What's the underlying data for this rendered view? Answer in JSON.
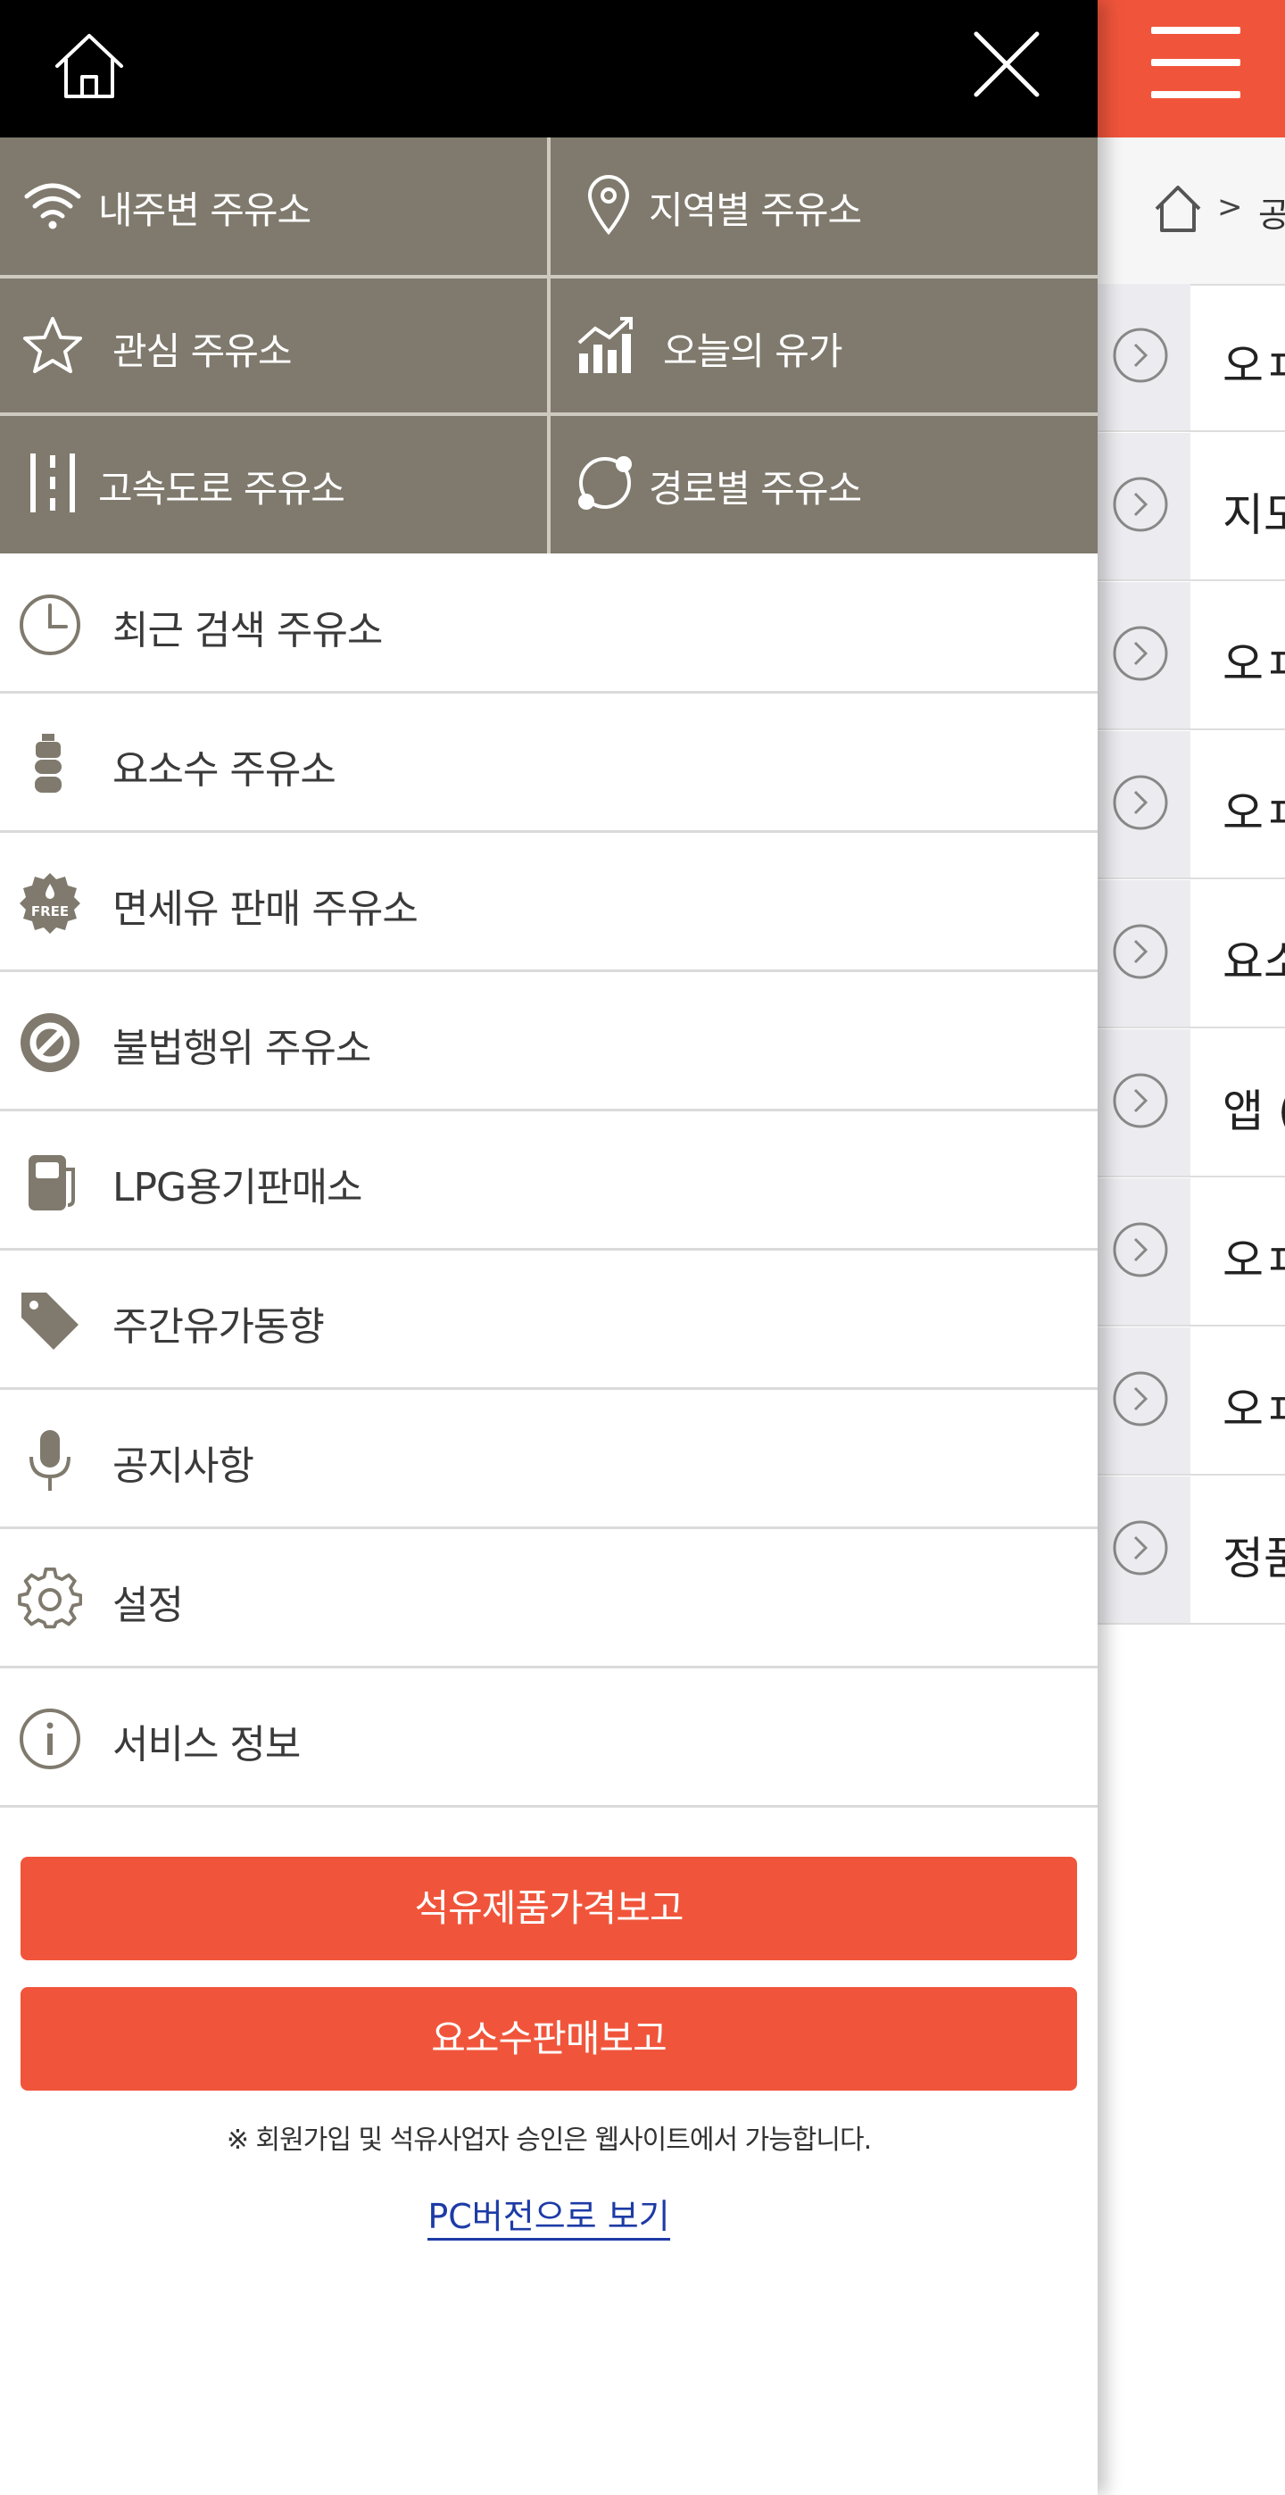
{
  "drawer": {
    "quick_grid": [
      {
        "label": "내주변 주유소",
        "icon": "wifi-icon"
      },
      {
        "label": "지역별 주유소",
        "icon": "location-pin-icon"
      },
      {
        "label": "관심 주유소",
        "icon": "star-icon"
      },
      {
        "label": "오늘의 유가",
        "icon": "chart-icon"
      },
      {
        "label": "고속도로 주유소",
        "icon": "highway-icon"
      },
      {
        "label": "경로별 주유소",
        "icon": "route-icon"
      }
    ],
    "menu": [
      {
        "label": "최근 검색 주유소",
        "icon": "clock-icon"
      },
      {
        "label": "요소수 주유소",
        "icon": "urea-bottle-icon"
      },
      {
        "label": "면세유 판매 주유소",
        "icon": "free-badge-icon",
        "badge_text": "FREE"
      },
      {
        "label": "불법행위 주유소",
        "icon": "prohibited-icon"
      },
      {
        "label": "LPG용기판매소",
        "icon": "lpg-cylinder-icon"
      },
      {
        "label": "주간유가동향",
        "icon": "price-tag-icon"
      },
      {
        "label": "공지사항",
        "icon": "microphone-icon"
      },
      {
        "label": "설정",
        "icon": "gear-icon"
      },
      {
        "label": "서비스 정보",
        "icon": "info-icon"
      }
    ],
    "buttons": {
      "petroleum_price_report": "석유제품가격보고",
      "urea_sales_report": "요소수판매보고"
    },
    "notice": "※ 회원가입 및 석유사업자 승인은 웹사이트에서 가능합니다.",
    "pc_version_link": "PC버전으로 보기"
  },
  "background_page": {
    "breadcrumb_separator": ">",
    "breadcrumb_text": "공",
    "rows": [
      "오ㅍ",
      "지도",
      "오ㅍ",
      "오ㅍ",
      "요소",
      "앱 (",
      "오ㅍ",
      "오ㅍ",
      "정품"
    ]
  },
  "colors": {
    "accent": "#f0553b",
    "grid_bg": "#7f7a6d",
    "header_bg": "#000000",
    "icon_color": "#7f7a6d",
    "link": "#1d3ba6"
  }
}
